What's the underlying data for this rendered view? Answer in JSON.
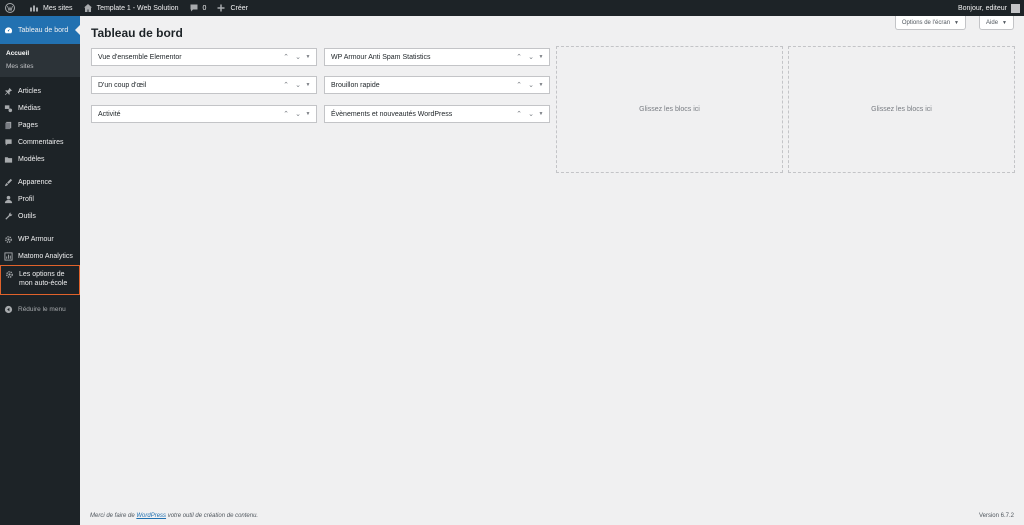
{
  "adminbar": {
    "my_sites": "Mes sites",
    "site_name": "Template 1 - Web Solution",
    "comments_count": "0",
    "create": "Créer",
    "greeting": "Bonjour, editeur"
  },
  "sidebar": {
    "dashboard": "Tableau de bord",
    "submenu": [
      "Accueil",
      "Mes sites"
    ],
    "items": [
      "Articles",
      "Médias",
      "Pages",
      "Commentaires",
      "Modèles",
      "Apparence",
      "Profil",
      "Outils",
      "WP Armour",
      "Matomo Analytics",
      "Les options de",
      "mon auto-école"
    ],
    "collapse": "Réduire le menu"
  },
  "main": {
    "title": "Tableau de bord",
    "screen_options": "Options de l'écran",
    "help": "Aide",
    "widgets": [
      "Vue d'ensemble Elementor",
      "D'un coup d'œil",
      "Activité",
      "WP Armour Anti Spam Statistics",
      "Brouillon rapide",
      "Évènements et nouveautés WordPress"
    ],
    "dropzone": "Glissez les blocs ici"
  },
  "footer": {
    "thanks_prefix": "Merci de faire de ",
    "wordpress": "WordPress",
    "thanks_suffix": " votre outil de création de contenu.",
    "version": "Version 6.7.2"
  },
  "colors": {
    "accent": "#2271b1",
    "highlight_border": "#e0622b",
    "sidebar_bg": "#1d2327"
  }
}
